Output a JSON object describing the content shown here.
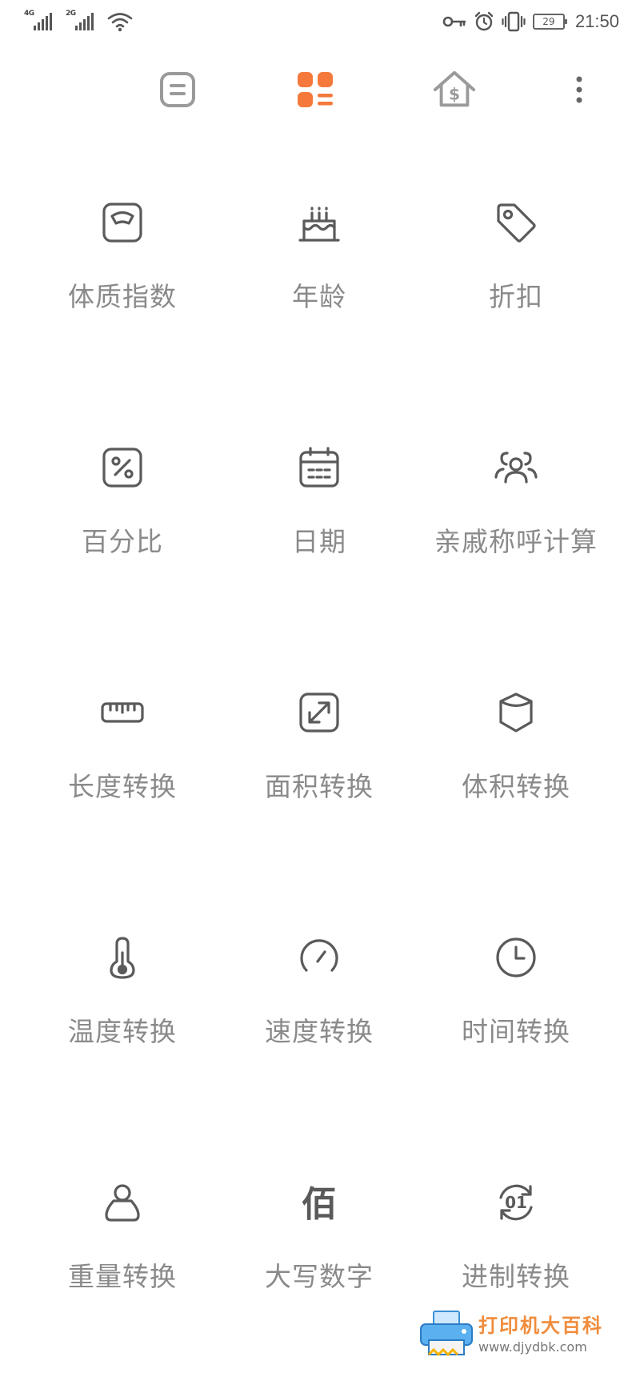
{
  "status_bar": {
    "network_1": "4G",
    "network_2": "2G",
    "battery": "29",
    "time": "21:50",
    "icons": [
      "signal-icon",
      "wifi-icon",
      "vpn-key-icon",
      "alarm-icon",
      "vibrate-icon",
      "battery-icon"
    ]
  },
  "top_nav": {
    "items": [
      {
        "name": "standard-calculator",
        "icon": "calculator-icon",
        "active": false
      },
      {
        "name": "tools",
        "icon": "grid-tools-icon",
        "active": true
      },
      {
        "name": "finance",
        "icon": "house-dollar-icon",
        "active": false
      },
      {
        "name": "more",
        "icon": "more-vertical-icon",
        "active": false
      }
    ],
    "accent_color": "#f5793b",
    "inactive_color": "#9a9a9a"
  },
  "tools": [
    {
      "label": "体质指数",
      "icon": "scale-icon"
    },
    {
      "label": "年龄",
      "icon": "cake-icon"
    },
    {
      "label": "折扣",
      "icon": "tag-icon"
    },
    {
      "label": "百分比",
      "icon": "percent-icon"
    },
    {
      "label": "日期",
      "icon": "calendar-icon"
    },
    {
      "label": "亲戚称呼计算",
      "icon": "people-icon"
    },
    {
      "label": "长度转换",
      "icon": "ruler-icon"
    },
    {
      "label": "面积转换",
      "icon": "expand-icon"
    },
    {
      "label": "体积转换",
      "icon": "cylinder-icon"
    },
    {
      "label": "温度转换",
      "icon": "thermometer-icon"
    },
    {
      "label": "速度转换",
      "icon": "speedometer-icon"
    },
    {
      "label": "时间转换",
      "icon": "clock-icon"
    },
    {
      "label": "重量转换",
      "icon": "weight-icon"
    },
    {
      "label": "大写数字",
      "icon": "bai-character-icon",
      "glyph": "佰"
    },
    {
      "label": "进制转换",
      "icon": "binary-cycle-icon",
      "glyph": "01"
    }
  ],
  "watermark": {
    "title": "打印机大百科",
    "url": "www.djydbk.com"
  }
}
